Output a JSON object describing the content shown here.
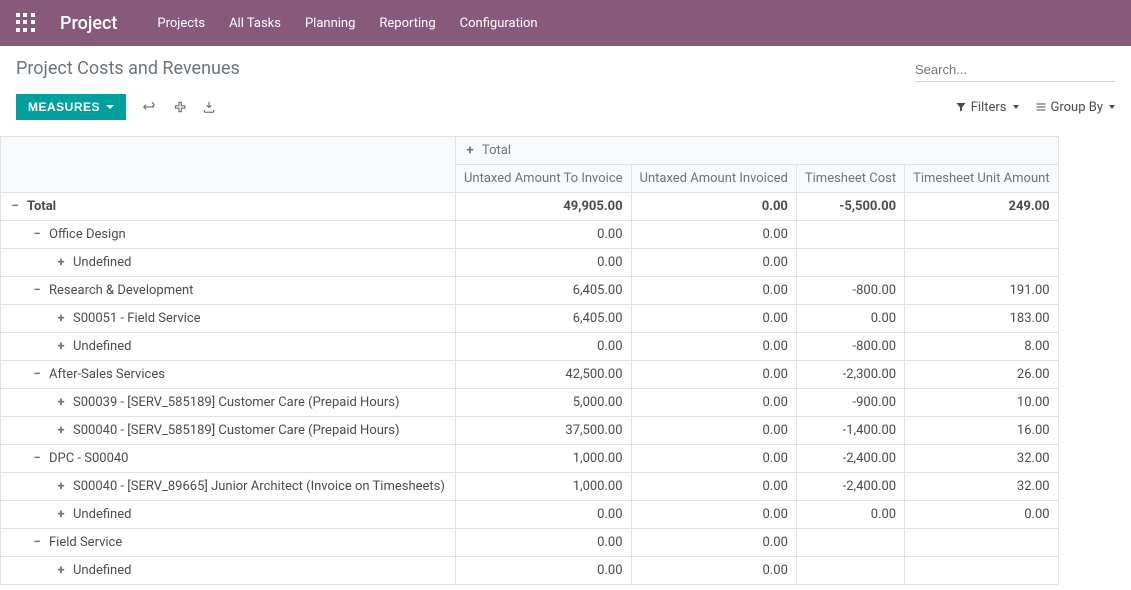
{
  "nav": {
    "brand": "Project",
    "items": [
      "Projects",
      "All Tasks",
      "Planning",
      "Reporting",
      "Configuration"
    ]
  },
  "page": {
    "title": "Project Costs and Revenues",
    "search_placeholder": "Search..."
  },
  "toolbar": {
    "measures": "MEASURES",
    "filters": "Filters",
    "group_by": "Group By"
  },
  "pivot": {
    "total_label": "Total",
    "columns": [
      "Untaxed Amount To Invoice",
      "Untaxed Amount Invoiced",
      "Timesheet Cost",
      "Timesheet Unit Amount"
    ],
    "rows": [
      {
        "label": "Total",
        "indent": 0,
        "exp": "-",
        "vals": [
          "49,905.00",
          "0.00",
          "-5,500.00",
          "249.00"
        ],
        "bold": true
      },
      {
        "label": "Office Design",
        "indent": 1,
        "exp": "-",
        "vals": [
          "0.00",
          "0.00",
          "",
          ""
        ]
      },
      {
        "label": "Undefined",
        "indent": 2,
        "exp": "+",
        "vals": [
          "0.00",
          "0.00",
          "",
          ""
        ]
      },
      {
        "label": "Research & Development",
        "indent": 1,
        "exp": "-",
        "vals": [
          "6,405.00",
          "0.00",
          "-800.00",
          "191.00"
        ]
      },
      {
        "label": "S00051 - Field Service",
        "indent": 2,
        "exp": "+",
        "vals": [
          "6,405.00",
          "0.00",
          "0.00",
          "183.00"
        ]
      },
      {
        "label": "Undefined",
        "indent": 2,
        "exp": "+",
        "vals": [
          "0.00",
          "0.00",
          "-800.00",
          "8.00"
        ]
      },
      {
        "label": "After-Sales Services",
        "indent": 1,
        "exp": "-",
        "vals": [
          "42,500.00",
          "0.00",
          "-2,300.00",
          "26.00"
        ]
      },
      {
        "label": "S00039 - [SERV_585189] Customer Care (Prepaid Hours)",
        "indent": 2,
        "exp": "+",
        "vals": [
          "5,000.00",
          "0.00",
          "-900.00",
          "10.00"
        ]
      },
      {
        "label": "S00040 - [SERV_585189] Customer Care (Prepaid Hours)",
        "indent": 2,
        "exp": "+",
        "vals": [
          "37,500.00",
          "0.00",
          "-1,400.00",
          "16.00"
        ]
      },
      {
        "label": "DPC - S00040",
        "indent": 1,
        "exp": "-",
        "vals": [
          "1,000.00",
          "0.00",
          "-2,400.00",
          "32.00"
        ]
      },
      {
        "label": "S00040 - [SERV_89665] Junior Architect (Invoice on Timesheets)",
        "indent": 2,
        "exp": "+",
        "vals": [
          "1,000.00",
          "0.00",
          "-2,400.00",
          "32.00"
        ]
      },
      {
        "label": "Undefined",
        "indent": 2,
        "exp": "+",
        "vals": [
          "0.00",
          "0.00",
          "0.00",
          "0.00"
        ]
      },
      {
        "label": "Field Service",
        "indent": 1,
        "exp": "-",
        "vals": [
          "0.00",
          "0.00",
          "",
          ""
        ]
      },
      {
        "label": "Undefined",
        "indent": 2,
        "exp": "+",
        "vals": [
          "0.00",
          "0.00",
          "",
          ""
        ]
      }
    ]
  }
}
